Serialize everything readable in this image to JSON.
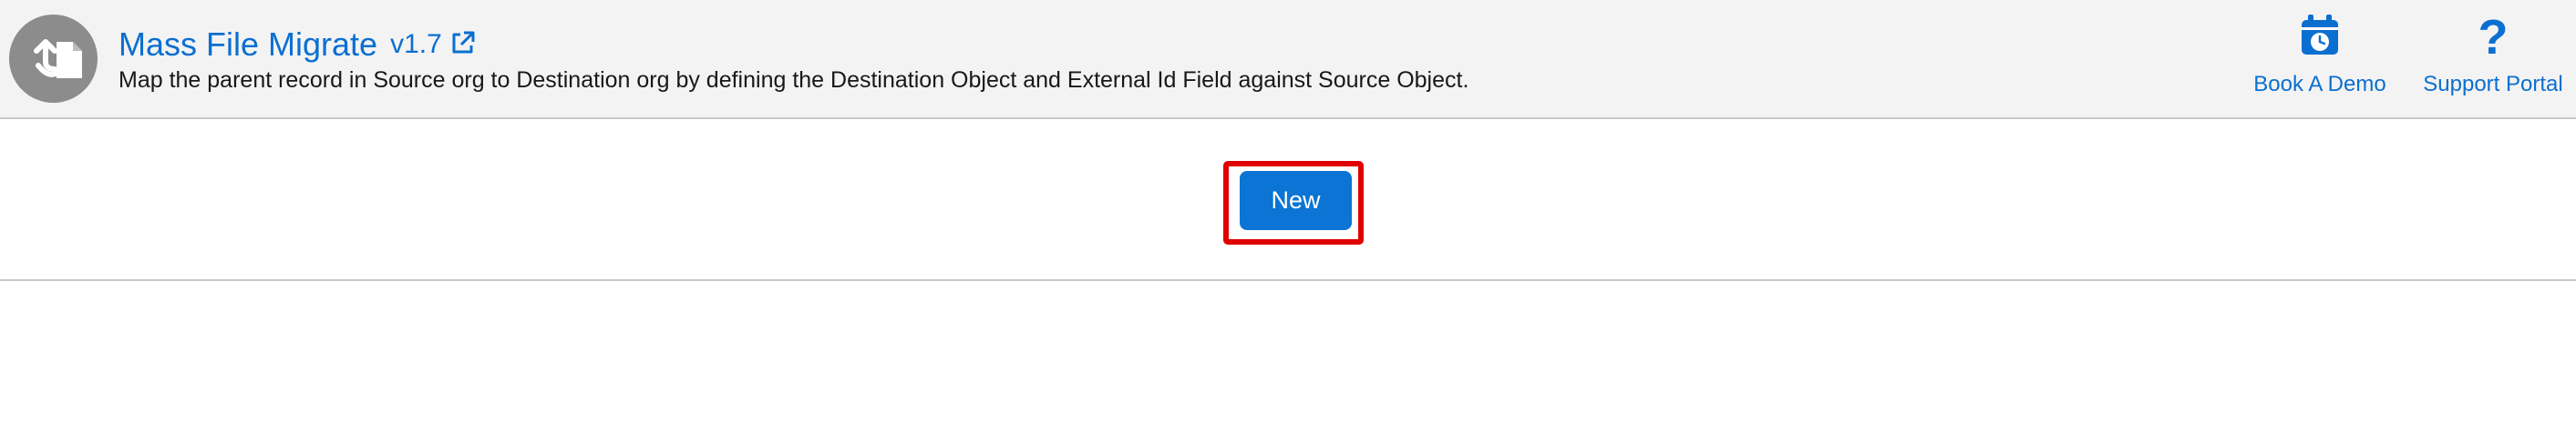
{
  "header": {
    "title": "Mass File Migrate",
    "version": "v1.7",
    "description": "Map the parent record in Source org to Destination org by defining the Destination Object and External Id Field against Source Object.",
    "app_icon": "file-migrate-icon",
    "external_link_icon": "external-link-icon"
  },
  "utility": {
    "book_demo": {
      "label": "Book A Demo",
      "icon": "calendar-clock-icon"
    },
    "support_portal": {
      "label": "Support Portal",
      "icon": "question-mark-icon",
      "glyph": "?"
    }
  },
  "actions": {
    "new_label": "New"
  },
  "colors": {
    "brand_blue": "#0b6fd0",
    "button_blue": "#0b74d4",
    "highlight_red": "#e00000",
    "header_bg": "#f3f3f3"
  }
}
